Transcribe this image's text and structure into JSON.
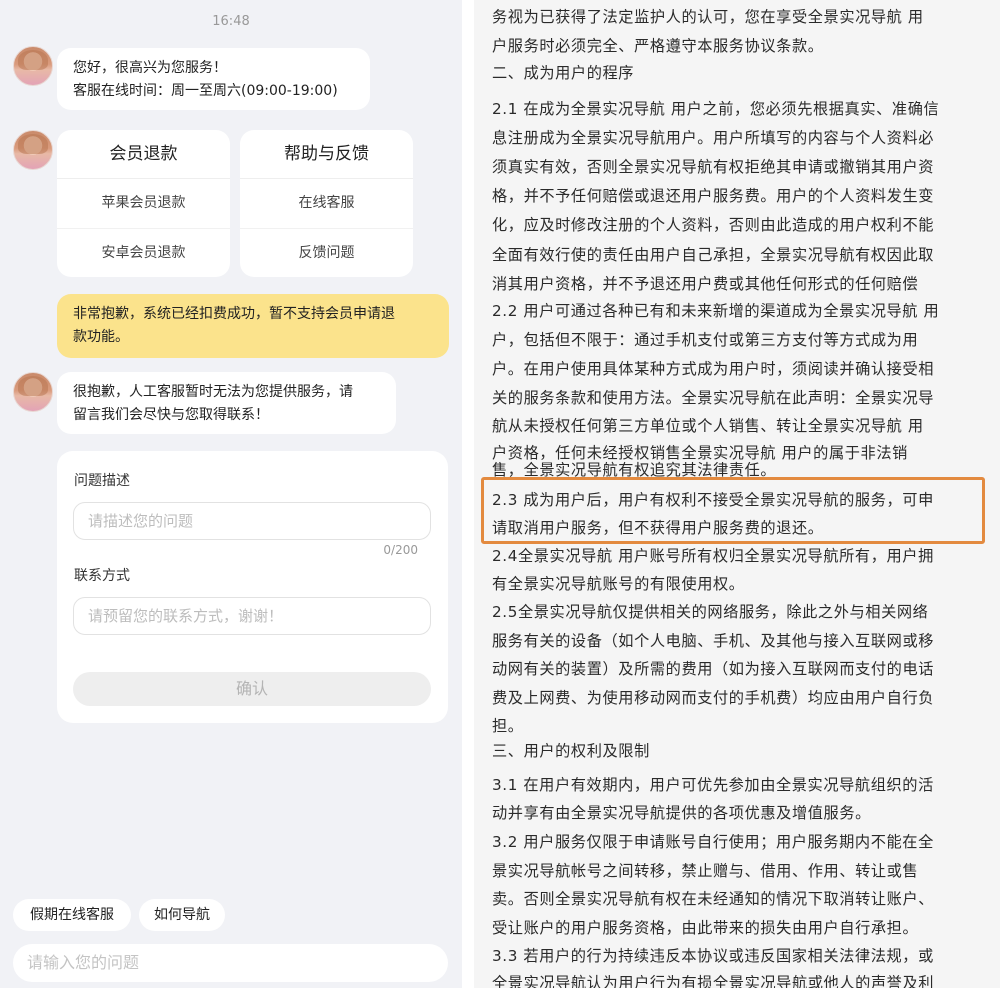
{
  "chat": {
    "time": "16:48",
    "greeting": [
      "您好，很高兴为您服务！",
      "客服在线时间：周一至周六(09:00-19:00)"
    ],
    "card_left": {
      "title": "会员退款",
      "items": [
        "苹果会员退款",
        "安卓会员退款"
      ]
    },
    "card_right": {
      "title": "帮助与反馈",
      "items": [
        "在线客服",
        "反馈问题"
      ]
    },
    "user_message": [
      "非常抱歉，系统已经扣费成功，暂不支持会员申请退",
      "款功能。"
    ],
    "reply": [
      "很抱歉，人工客服暂时无法为您提供服务，请",
      "留言我们会尽快与您取得联系！"
    ],
    "form": {
      "desc_label": "问题描述",
      "desc_placeholder": "请描述您的问题",
      "counter": "0/200",
      "contact_label": "联系方式",
      "contact_placeholder": "请预留您的联系方式，谢谢！",
      "confirm_label": "确认"
    },
    "quick_replies": [
      "假期在线客服",
      "如何导航"
    ],
    "input_placeholder": "请输入您的问题"
  },
  "agreement": {
    "lines": [
      "务视为已获得了法定监护人的认可，您在享受全景实况导航 用",
      "户服务时必须完全、严格遵守本服务协议条款。",
      "二、成为用户的程序",
      "2.1 在成为全景实况导航 用户之前，您必须先根据真实、准确信",
      "息注册成为全景实况导航用户。用户所填写的内容与个人资料必",
      "须真实有效，否则全景实况导航有权拒绝其申请或撤销其用户资",
      "格，并不予任何赔偿或退还用户服务费。用户的个人资料发生变",
      "化，应及时修改注册的个人资料，否则由此造成的用户权利不能",
      "全面有效行使的责任由用户自己承担，全景实况导航有权因此取",
      "消其用户资格，并不予退还用户费或其他任何形式的任何赔偿",
      "2.2 用户可通过各种已有和未来新增的渠道成为全景实况导航 用",
      "户，包括但不限于：通过手机支付或第三方支付等方式成为用",
      "户。在用户使用具体某种方式成为用户时，须阅读并确认接受相",
      "关的服务条款和使用方法。全景实况导航在此声明：全景实况导",
      "航从未授权任何第三方单位或个人销售、转让全景实况导航 用",
      "户资格，任何未经授权销售全景实况导航 用户的属于非法销",
      "售，全景实况导航有权追究其法律责任。",
      "2.3 成为用户后，用户有权利不接受全景实况导航的服务，可申",
      "请取消用户服务，但不获得用户服务费的退还。",
      "2.4全景实况导航 用户账号所有权归全景实况导航所有，用户拥",
      "有全景实况导航账号的有限使用权。",
      "2.5全景实况导航仅提供相关的网络服务，除此之外与相关网络",
      "服务有关的设备（如个人电脑、手机、及其他与接入互联网或移",
      "动网有关的装置）及所需的费用（如为接入互联网而支付的电话",
      "费及上网费、为使用移动网而支付的手机费）均应由用户自行负",
      "担。",
      "三、用户的权利及限制",
      "3.1 在用户有效期内，用户可优先参加由全景实况导航组织的活",
      "动并享有由全景实况导航提供的各项优惠及增值服务。",
      "3.2 用户服务仅限于申请账号自行使用；用户服务期内不能在全",
      "景实况导航帐号之间转移，禁止赠与、借用、作用、转让或售",
      "卖。否则全景实况导航有权在未经通知的情况下取消转让账户、",
      "受让账户的用户服务资格，由此带来的损失由用户自行承担。",
      "3.3 若用户的行为持续违反本协议或违反国家相关法律法规，或",
      "全景实况导航认为用户行为有损全景实况导航或他人的声誉及利"
    ]
  }
}
